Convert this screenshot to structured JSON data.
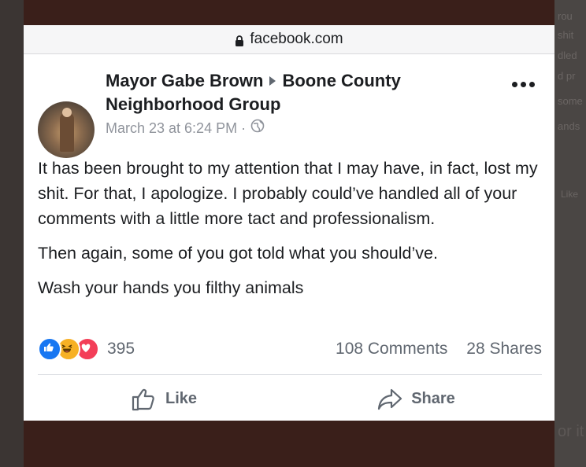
{
  "browser": {
    "url": "facebook.com"
  },
  "post": {
    "author": "Mayor Gabe Brown",
    "group": "Boone County Neighborhood Group",
    "timestamp": "March 23 at 6:24 PM",
    "separator": "·",
    "paragraphs": [
      "It has been brought to my attention that I may have, in fact, lost my shit. For that, I apologize. I probably could’ve handled all of your comments with a little more tact and professionalism.",
      "Then again, some of you got told what you should’ve.",
      "Wash your hands you filthy animals"
    ],
    "reactions": {
      "icons": [
        "like-icon",
        "haha-icon",
        "love-icon"
      ],
      "count": "395"
    },
    "comments": "108 Comments",
    "shares": "28 Shares",
    "actions": {
      "like": "Like",
      "share": "Share"
    }
  },
  "background_ghost": {
    "lines": [
      "rou",
      "shit",
      "dled",
      "d pr",
      "some",
      "ands"
    ],
    "like": "Like",
    "big": "or it"
  },
  "colors": {
    "accent": "#1877f2",
    "muted": "#606770",
    "love": "#f33e58",
    "haha": "#f7b125"
  }
}
